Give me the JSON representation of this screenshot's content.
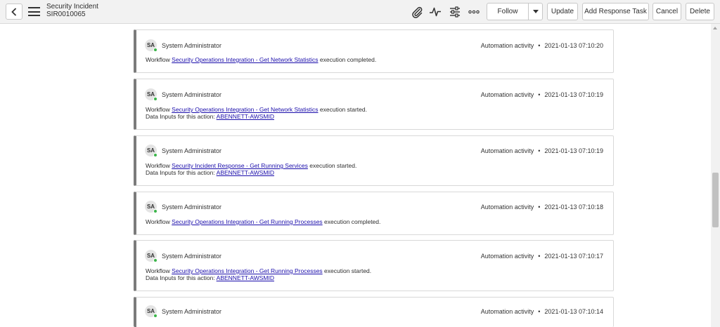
{
  "header": {
    "title": "Security Incident",
    "record_number": "SIR0010065",
    "buttons": {
      "follow": "Follow",
      "update": "Update",
      "add_response_task": "Add Response Task",
      "cancel": "Cancel",
      "delete": "Delete"
    }
  },
  "activities": [
    {
      "initials": "SA",
      "user": "System Administrator",
      "type": "Automation activity",
      "timestamp": "2021-01-13 07:10:20",
      "prefix": "Workflow",
      "link": "Security Operations Integration - Get Network Statistics",
      "suffix": "execution completed.",
      "inputs_label": "",
      "inputs_value": ""
    },
    {
      "initials": "SA",
      "user": "System Administrator",
      "type": "Automation activity",
      "timestamp": "2021-01-13 07:10:19",
      "prefix": "Workflow",
      "link": "Security Operations Integration - Get Network Statistics",
      "suffix": "execution started.",
      "inputs_label": "Data Inputs for this action:",
      "inputs_value": "ABENNETT-AWSMID"
    },
    {
      "initials": "SA",
      "user": "System Administrator",
      "type": "Automation activity",
      "timestamp": "2021-01-13 07:10:19",
      "prefix": "Workflow",
      "link": "Security Incident Response - Get Running Services",
      "suffix": "execution started.",
      "inputs_label": "Data Inputs for this action:",
      "inputs_value": "ABENNETT-AWSMID"
    },
    {
      "initials": "SA",
      "user": "System Administrator",
      "type": "Automation activity",
      "timestamp": "2021-01-13 07:10:18",
      "prefix": "Workflow",
      "link": "Security Operations Integration - Get Running Processes",
      "suffix": "execution completed.",
      "inputs_label": "",
      "inputs_value": ""
    },
    {
      "initials": "SA",
      "user": "System Administrator",
      "type": "Automation activity",
      "timestamp": "2021-01-13 07:10:17",
      "prefix": "Workflow",
      "link": "Security Operations Integration - Get Running Processes",
      "suffix": "execution started.",
      "inputs_label": "Data Inputs for this action:",
      "inputs_value": "ABENNETT-AWSMID"
    },
    {
      "initials": "SA",
      "user": "System Administrator",
      "type": "Automation activity",
      "timestamp": "2021-01-13 07:10:14",
      "prefix": "",
      "link": "",
      "suffix": "",
      "inputs_label": "",
      "inputs_value": ""
    }
  ]
}
